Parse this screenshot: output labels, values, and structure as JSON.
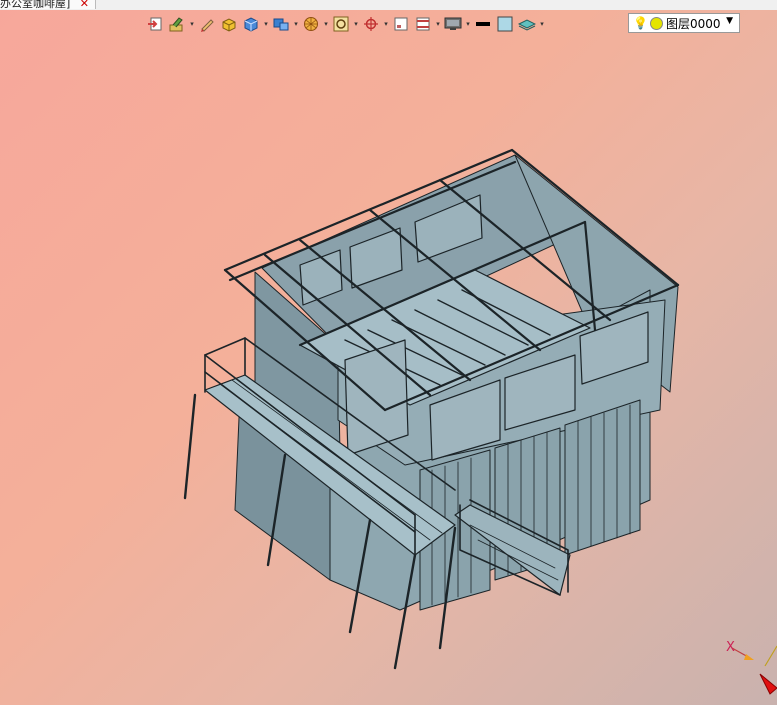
{
  "tab": {
    "title": "办公室咖啡屋]",
    "close_glyph": "✕"
  },
  "toolbar": {
    "buttons": [
      {
        "name": "exit-sketch-icon",
        "color": "#d04040"
      },
      {
        "name": "sketch-edit-icon",
        "color": "#c8a020"
      },
      {
        "name": "pencil-icon",
        "color": "#d0a050"
      },
      {
        "name": "box-face-icon",
        "color": "#e0b020"
      },
      {
        "name": "cube-icon",
        "color": "#3070c0"
      },
      {
        "name": "blocks-icon",
        "color": "#3080d0"
      },
      {
        "name": "sphere-icon",
        "color": "#e0a030"
      },
      {
        "name": "zoom-fit-icon",
        "color": "#c09030"
      },
      {
        "name": "crosshair-icon",
        "color": "#c03030"
      },
      {
        "name": "view-frame-icon",
        "color": "#806060"
      },
      {
        "name": "section-icon",
        "color": "#c04040"
      },
      {
        "name": "display-icon",
        "color": "#505050"
      },
      {
        "name": "line-weight-icon",
        "color": "#000000"
      },
      {
        "name": "color-swatch-icon",
        "color": "#add8e6"
      },
      {
        "name": "layers-icon",
        "color": "#40a0a0"
      }
    ]
  },
  "layer": {
    "label": "图层0000",
    "bulb": "💡"
  },
  "triad": {
    "x_label": "X"
  }
}
